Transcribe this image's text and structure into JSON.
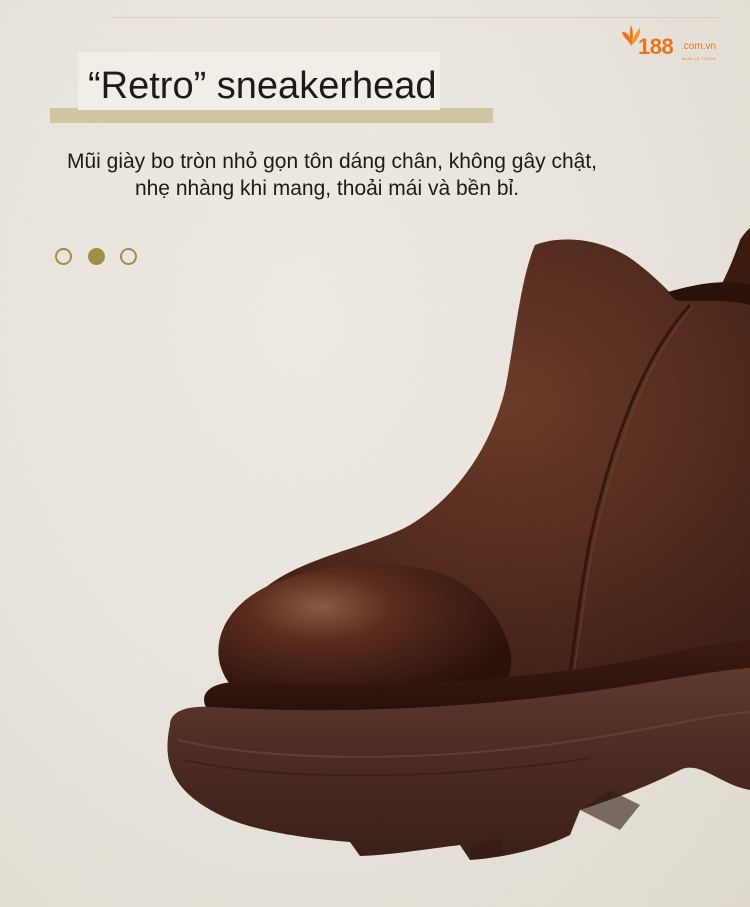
{
  "brand": {
    "name": "188",
    "domain": ".com.vn",
    "tagline": "MUA LÀ THÍCH",
    "accent_color": "#e8741c"
  },
  "hero": {
    "title": "“Retro” sneakerhead",
    "description_line1": "Mũi giày bo tròn nhỏ gọn tôn dáng chân, không gây chật,",
    "description_line2": "nhẹ nhàng khi mang, thoải mái và bền bỉ.",
    "accent_color": "#9c9047"
  },
  "carousel": {
    "dot_count": 3,
    "active_index": 1
  },
  "product_image": {
    "subject": "brown leather ankle boot",
    "leather_color": "#4a2218",
    "sole_color": "#4b2b22"
  }
}
